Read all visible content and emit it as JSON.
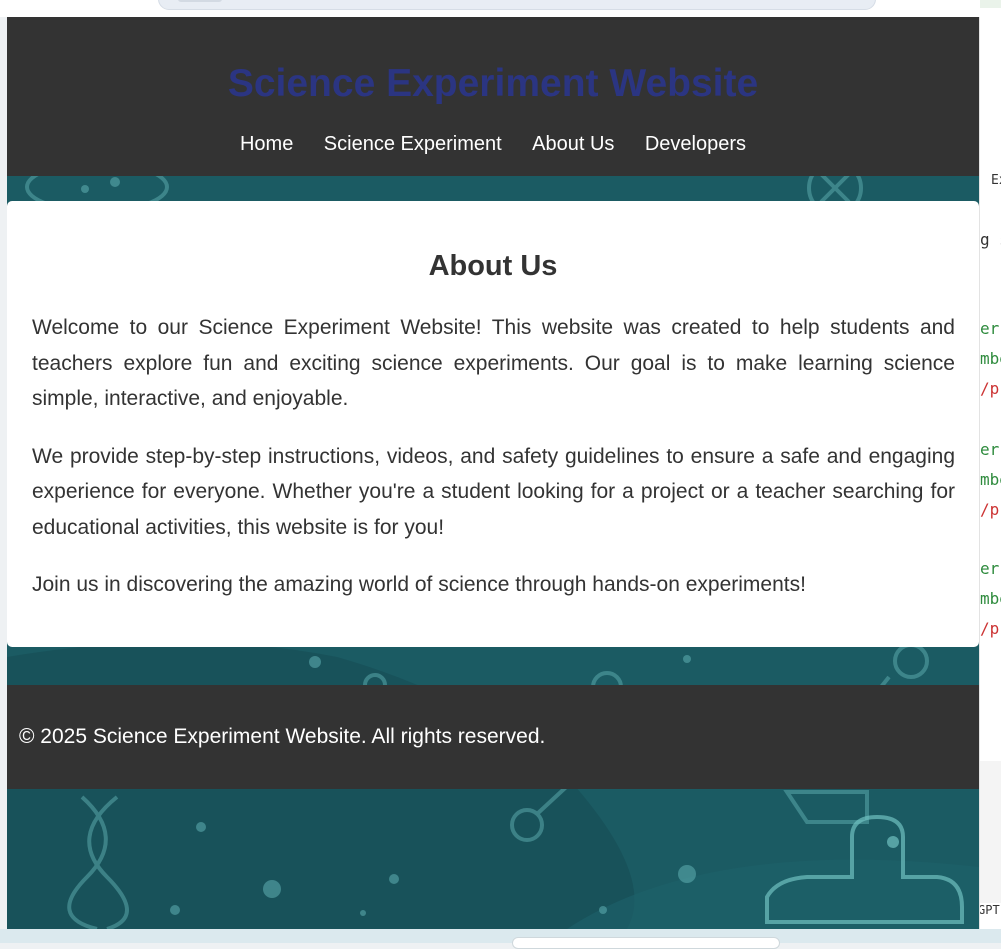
{
  "site": {
    "title": "Science Experiment Website",
    "nav": [
      "Home",
      "Science Experiment",
      "About Us",
      "Developers"
    ]
  },
  "about": {
    "heading": "About Us",
    "paragraphs": [
      "Welcome to our Science Experiment Website! This website was created to help students and teachers explore fun and exciting science experiments. Our goal is to make learning science simple, interactive, and enjoyable.",
      "We provide step-by-step instructions, videos, and safety guidelines to ensure a safe and engaging experience for everyone. Whether you're a student looking for a project or a teacher searching for educational activities, this website is for you!",
      "Join us in discovering the amazing world of science through hands-on experiments!"
    ]
  },
  "footer": {
    "text": "© 2025 Science Experiment Website. All rights reserved."
  },
  "side_code_peek": [
    "Ex",
    "g s",
    "er",
    "mbe",
    "/p",
    "er",
    "mbe",
    "/p",
    "er",
    "mbe",
    "/p",
    "GPT"
  ],
  "colors": {
    "header_bg": "#333333",
    "title": "#2b3582",
    "page_bg": "#1b5b63",
    "card_bg": "#ffffff",
    "text": "#333333"
  }
}
